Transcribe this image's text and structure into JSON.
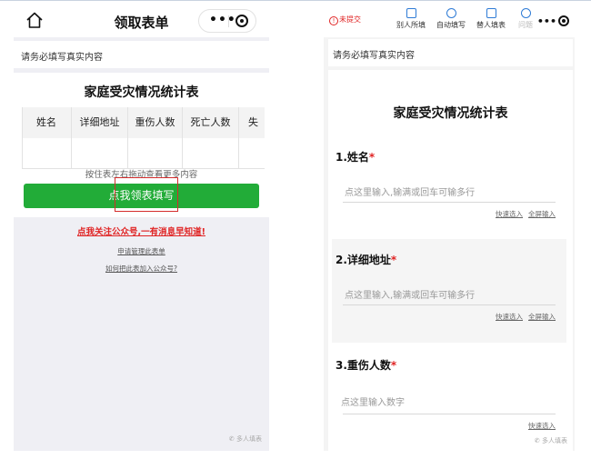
{
  "left": {
    "nav": {
      "title": "领取表单",
      "home_icon": "home-icon",
      "menu_dots": "•••"
    },
    "notice": "请务必填写真实内容",
    "form": {
      "title": "家庭受灾情况统计表",
      "columns": [
        "姓名",
        "详细地址",
        "重伤人数",
        "死亡人数",
        "失"
      ],
      "hint": "按住表左右拖动查看更多内容",
      "claim_button": "点我领表填写"
    },
    "follow_link": "点我关注公众号,一有消息早知道!",
    "links": [
      "申请管理此表单",
      "如何把此表加入公众号?"
    ],
    "watermark": "多人填表"
  },
  "right": {
    "toolbar": {
      "unsubmitted": "未提交",
      "items": [
        "别人所填",
        "自动填写",
        "替人填表",
        "问题"
      ]
    },
    "notice": "请务必填写真实内容",
    "form": {
      "title": "家庭受灾情况统计表",
      "questions": [
        {
          "label": "1.姓名",
          "placeholder": "点这里输入,输满或回车可输多行",
          "links": [
            "快速选入",
            "全屏输入"
          ]
        },
        {
          "label": "2.详细地址",
          "placeholder": "点这里输入,输满或回车可输多行",
          "links": [
            "快速选入",
            "全屏输入"
          ]
        },
        {
          "label": "3.重伤人数",
          "placeholder": "点这里输入数字",
          "links": [
            "快速选入"
          ]
        }
      ],
      "required_mark": "*"
    },
    "watermark": "多人填表"
  },
  "colors": {
    "green": "#22ac38",
    "red": "#e02424",
    "highlight_box": "#d42d2d",
    "toolbar_icon": "#2e7bd6"
  }
}
